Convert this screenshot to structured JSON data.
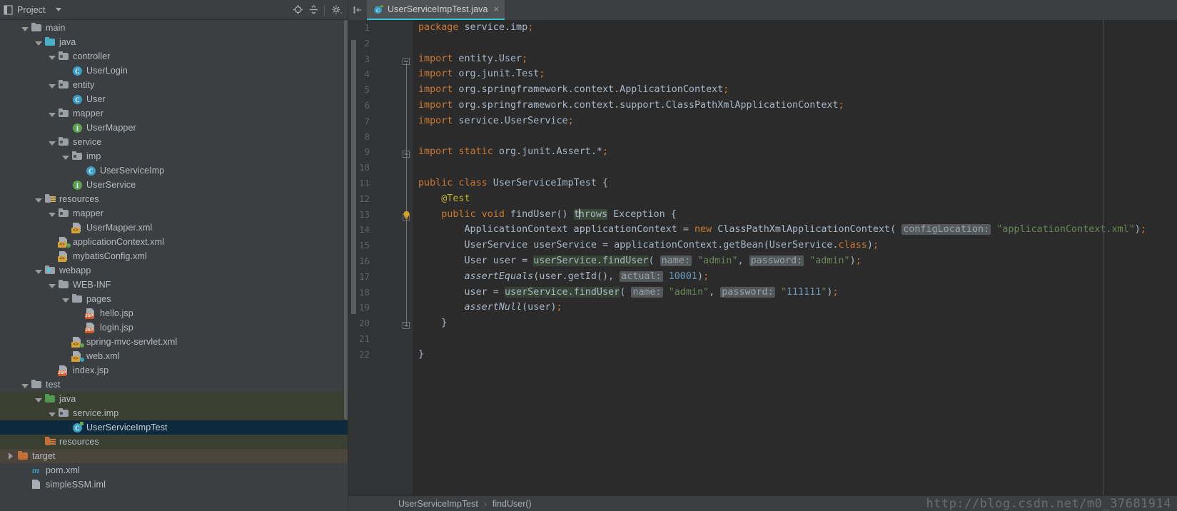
{
  "project_panel": {
    "title": "Project",
    "icons": [
      "project-icon",
      "chevron-down-icon",
      "locate-icon",
      "collapse-all-icon",
      "settings-gear-icon"
    ],
    "tree": [
      {
        "indent": 1,
        "arrow": "down",
        "icon": "folder-grey",
        "label": "main",
        "state": "none"
      },
      {
        "indent": 2,
        "arrow": "down",
        "icon": "folder-blue-src",
        "label": "java",
        "state": "none"
      },
      {
        "indent": 3,
        "arrow": "down",
        "icon": "package",
        "label": "controller",
        "state": "none"
      },
      {
        "indent": 4,
        "arrow": "none",
        "icon": "class",
        "label": "UserLogin",
        "state": "none"
      },
      {
        "indent": 3,
        "arrow": "down",
        "icon": "package",
        "label": "entity",
        "state": "none"
      },
      {
        "indent": 4,
        "arrow": "none",
        "icon": "class",
        "label": "User",
        "state": "none"
      },
      {
        "indent": 3,
        "arrow": "down",
        "icon": "package",
        "label": "mapper",
        "state": "none"
      },
      {
        "indent": 4,
        "arrow": "none",
        "icon": "interface",
        "label": "UserMapper",
        "state": "none"
      },
      {
        "indent": 3,
        "arrow": "down",
        "icon": "package",
        "label": "service",
        "state": "none"
      },
      {
        "indent": 4,
        "arrow": "down",
        "icon": "package",
        "label": "imp",
        "state": "none"
      },
      {
        "indent": 5,
        "arrow": "none",
        "icon": "class",
        "label": "UserServiceImp",
        "state": "none"
      },
      {
        "indent": 4,
        "arrow": "none",
        "icon": "interface",
        "label": "UserService",
        "state": "none"
      },
      {
        "indent": 2,
        "arrow": "down",
        "icon": "folder-resources",
        "label": "resources",
        "state": "none"
      },
      {
        "indent": 3,
        "arrow": "down",
        "icon": "package",
        "label": "mapper",
        "state": "none"
      },
      {
        "indent": 4,
        "arrow": "none",
        "icon": "xml-file",
        "label": "UserMapper.xml",
        "state": "none"
      },
      {
        "indent": 3,
        "arrow": "none",
        "icon": "spring-xml-file",
        "label": "applicationContext.xml",
        "state": "none"
      },
      {
        "indent": 3,
        "arrow": "none",
        "icon": "xml-file",
        "label": "mybatisConfig.xml",
        "state": "none"
      },
      {
        "indent": 2,
        "arrow": "down",
        "icon": "folder-webapp",
        "label": "webapp",
        "state": "none"
      },
      {
        "indent": 3,
        "arrow": "down",
        "icon": "folder-grey",
        "label": "WEB-INF",
        "state": "none"
      },
      {
        "indent": 4,
        "arrow": "down",
        "icon": "folder-grey",
        "label": "pages",
        "state": "none"
      },
      {
        "indent": 5,
        "arrow": "none",
        "icon": "jsp-file",
        "label": "hello.jsp",
        "state": "none"
      },
      {
        "indent": 5,
        "arrow": "none",
        "icon": "jsp-file",
        "label": "login.jsp",
        "state": "none"
      },
      {
        "indent": 4,
        "arrow": "none",
        "icon": "spring-xml-file",
        "label": "spring-mvc-servlet.xml",
        "state": "none"
      },
      {
        "indent": 4,
        "arrow": "none",
        "icon": "web-xml-file",
        "label": "web.xml",
        "state": "none"
      },
      {
        "indent": 3,
        "arrow": "none",
        "icon": "jsp-file",
        "label": "index.jsp",
        "state": "none"
      },
      {
        "indent": 1,
        "arrow": "down",
        "icon": "folder-grey",
        "label": "test",
        "state": "none"
      },
      {
        "indent": 2,
        "arrow": "down",
        "icon": "folder-green-test",
        "label": "java",
        "state": "test"
      },
      {
        "indent": 3,
        "arrow": "down",
        "icon": "package",
        "label": "service.imp",
        "state": "test"
      },
      {
        "indent": 4,
        "arrow": "none",
        "icon": "test-class",
        "label": "UserServiceImpTest",
        "state": "selected"
      },
      {
        "indent": 2,
        "arrow": "none",
        "icon": "folder-test-res",
        "label": "resources",
        "state": "test"
      },
      {
        "indent": 0,
        "arrow": "right",
        "icon": "folder-orange",
        "label": "target",
        "state": "target"
      },
      {
        "indent": 1,
        "arrow": "none",
        "icon": "maven-file",
        "label": "pom.xml",
        "state": "none"
      },
      {
        "indent": 1,
        "arrow": "none",
        "icon": "iml-file",
        "label": "simpleSSM.iml",
        "state": "none"
      }
    ]
  },
  "editor": {
    "tab": {
      "icon": "test-class-icon",
      "label": "UserServiceImpTest.java",
      "close": "×",
      "accent_color": "#35c4d6"
    },
    "line_count": 22,
    "gutter_line_numbers": [
      "1",
      "2",
      "3",
      "4",
      "5",
      "6",
      "7",
      "8",
      "9",
      "10",
      "11",
      "12",
      "13",
      "14",
      "15",
      "16",
      "17",
      "18",
      "19",
      "20",
      "21",
      "22"
    ],
    "run_marker_lines": [
      11,
      13
    ],
    "fold_marker_lines": [
      3,
      9,
      13,
      20
    ],
    "bulb_line": 13,
    "code_lines": [
      "package service.imp;",
      "",
      "import entity.User;",
      "import org.junit.Test;",
      "import org.springframework.context.ApplicationContext;",
      "import org.springframework.context.support.ClassPathXmlApplicationContext;",
      "import service.UserService;",
      "",
      "import static org.junit.Assert.*;",
      "",
      "public class UserServiceImpTest {",
      "    @Test",
      "    public void findUser() throws Exception {",
      "        ApplicationContext applicationContext = new ClassPathXmlApplicationContext( configLocation: \"applicationContext.xml\");",
      "        UserService userService = applicationContext.getBean(UserService.class);",
      "        User user = userService.findUser( name: \"admin\", password: \"admin\");",
      "        assertEquals(user.getId(), actual: 10001);",
      "        user = userService.findUser( name: \"admin\", password: \"111111\");",
      "        assertNull(user);",
      "    }",
      "",
      "}"
    ],
    "parameter_hints": [
      "configLocation:",
      "name:",
      "password:",
      "actual:"
    ],
    "caret_line": 13,
    "caret_word": "throws"
  },
  "breadcrumb": {
    "items": [
      "UserServiceImpTest",
      "findUser()"
    ],
    "separator": "›"
  },
  "watermark": "http://blog.csdn.net/m0_37681914"
}
